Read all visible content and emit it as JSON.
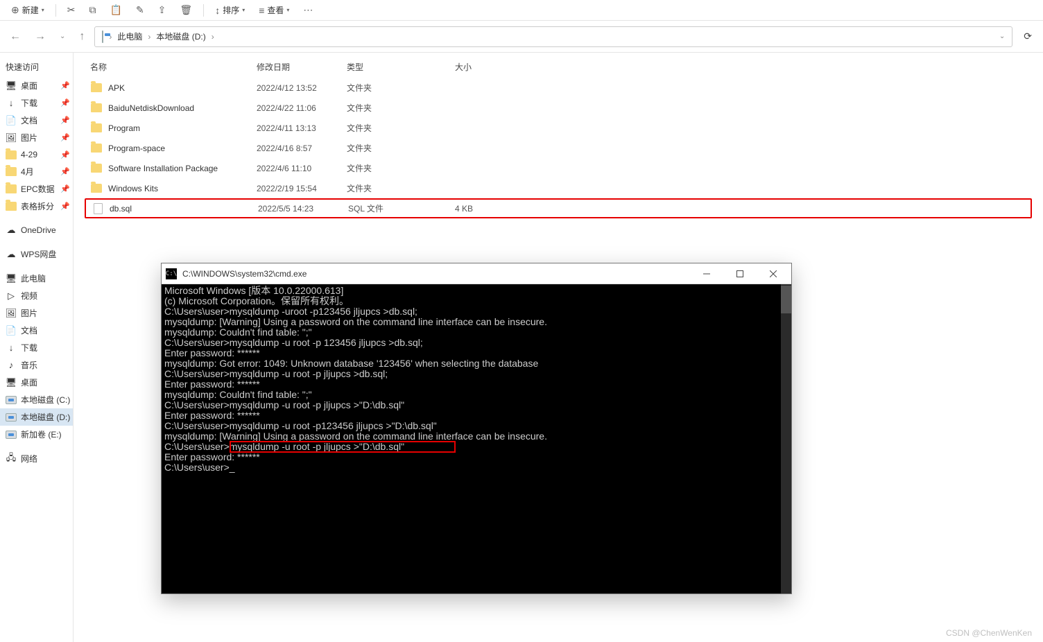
{
  "toolbar": {
    "new": "新建",
    "sort": "排序",
    "view": "查看"
  },
  "address": {
    "root": "此电脑",
    "drive": "本地磁盘 (D:)"
  },
  "sidebar": {
    "quick": "快速访问",
    "items_pinned": [
      {
        "label": "桌面",
        "icon": "desktop"
      },
      {
        "label": "下载",
        "icon": "download"
      },
      {
        "label": "文档",
        "icon": "docs"
      },
      {
        "label": "图片",
        "icon": "pics"
      },
      {
        "label": "4-29",
        "icon": "folder"
      },
      {
        "label": "4月",
        "icon": "folder"
      },
      {
        "label": "EPC数据",
        "icon": "folder"
      },
      {
        "label": "表格拆分",
        "icon": "folder"
      }
    ],
    "onedrive": "OneDrive",
    "wps": "WPS网盘",
    "thispc": "此电脑",
    "pc_items": [
      {
        "label": "视频"
      },
      {
        "label": "图片"
      },
      {
        "label": "文档"
      },
      {
        "label": "下载"
      },
      {
        "label": "音乐"
      },
      {
        "label": "桌面"
      },
      {
        "label": "本地磁盘 (C:)"
      },
      {
        "label": "本地磁盘 (D:)",
        "sel": true
      },
      {
        "label": "新加卷 (E:)"
      }
    ],
    "network": "网络"
  },
  "columns": {
    "name": "名称",
    "date": "修改日期",
    "type": "类型",
    "size": "大小"
  },
  "files": [
    {
      "name": "APK",
      "date": "2022/4/12 13:52",
      "type": "文件夹",
      "size": "",
      "kind": "folder"
    },
    {
      "name": "BaiduNetdiskDownload",
      "date": "2022/4/22 11:06",
      "type": "文件夹",
      "size": "",
      "kind": "folder"
    },
    {
      "name": "Program",
      "date": "2022/4/11 13:13",
      "type": "文件夹",
      "size": "",
      "kind": "folder"
    },
    {
      "name": "Program-space",
      "date": "2022/4/16 8:57",
      "type": "文件夹",
      "size": "",
      "kind": "folder"
    },
    {
      "name": "Software Installation Package",
      "date": "2022/4/6 11:10",
      "type": "文件夹",
      "size": "",
      "kind": "folder"
    },
    {
      "name": "Windows Kits",
      "date": "2022/2/19 15:54",
      "type": "文件夹",
      "size": "",
      "kind": "folder"
    },
    {
      "name": "db.sql",
      "date": "2022/5/5 14:23",
      "type": "SQL 文件",
      "size": "4 KB",
      "kind": "file",
      "hl": true
    }
  ],
  "cmd": {
    "title": "C:\\WINDOWS\\system32\\cmd.exe",
    "lines": [
      "Microsoft Windows [版本 10.0.22000.613]",
      "(c) Microsoft Corporation。保留所有权利。",
      "",
      "C:\\Users\\user>mysqldump -uroot -p123456 jljupcs >db.sql;",
      "mysqldump: [Warning] Using a password on the command line interface can be insecure.",
      "mysqldump: Couldn't find table: \";\"",
      "",
      "C:\\Users\\user>mysqldump -u root -p 123456 jljupcs >db.sql;",
      "Enter password: ******",
      "mysqldump: Got error: 1049: Unknown database '123456' when selecting the database",
      "",
      "C:\\Users\\user>mysqldump -u root -p jljupcs >db.sql;",
      "Enter password: ******",
      "mysqldump: Couldn't find table: \";\"",
      "",
      "C:\\Users\\user>mysqldump -u root -p jljupcs >\"D:\\db.sql\"",
      "Enter password: ******",
      "",
      "C:\\Users\\user>mysqldump -u root -p123456 jljupcs >\"D:\\db.sql\"",
      "mysqldump: [Warning] Using a password on the command line interface can be insecure.",
      "",
      "C:\\Users\\user>mysqldump -u root -p jljupcs >\"D:\\db.sql\"",
      "Enter password: ******",
      "",
      "C:\\Users\\user>_"
    ],
    "hl_line": 15
  },
  "watermark": "CSDN @ChenWenKen"
}
